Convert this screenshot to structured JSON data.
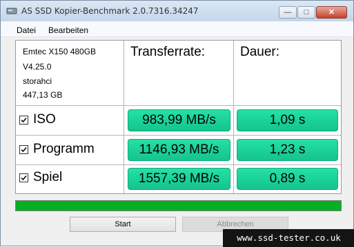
{
  "window": {
    "title": "AS SSD Kopier-Benchmark 2.0.7316.34247"
  },
  "menu": {
    "items": [
      "Datei",
      "Bearbeiten"
    ]
  },
  "drive": {
    "model": "Emtec X150 480GB",
    "firmware": "V4.25.0",
    "driver": "storahci",
    "size": "447,13 GB"
  },
  "columns": {
    "rate": "Transferrate:",
    "duration": "Dauer:"
  },
  "rows": [
    {
      "label": "ISO",
      "checked": true,
      "rate": "983,99 MB/s",
      "duration": "1,09 s"
    },
    {
      "label": "Programm",
      "checked": true,
      "rate": "1146,93 MB/s",
      "duration": "1,23 s"
    },
    {
      "label": "Spiel",
      "checked": true,
      "rate": "1557,39 MB/s",
      "duration": "0,89 s"
    }
  ],
  "progress": {
    "percent": 100,
    "color": "#06b025"
  },
  "buttons": {
    "start": "Start",
    "abort": "Abbrechen"
  },
  "watermark": "www.ssd-tester.co.uk",
  "colors": {
    "result_bar": "#1ad398",
    "titlebar": "#c4d6ea"
  }
}
